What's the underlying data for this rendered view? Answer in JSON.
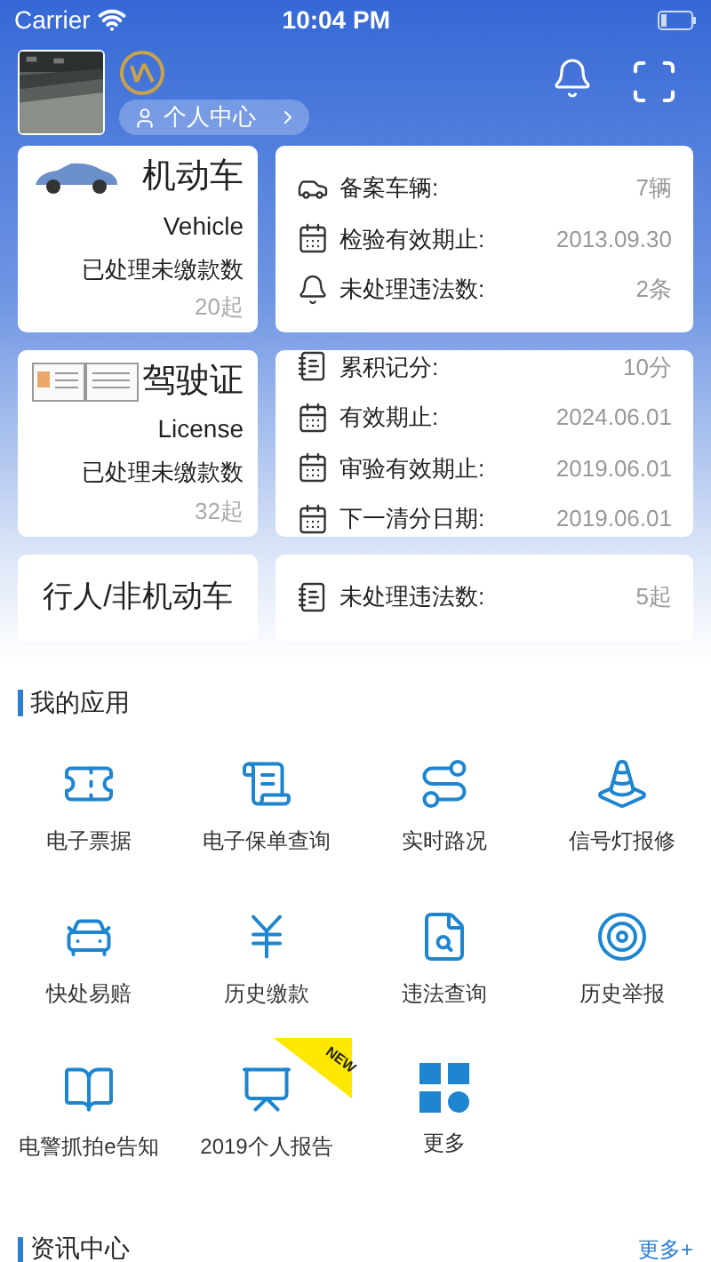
{
  "status_bar": {
    "carrier": "Carrier",
    "time": "10:04 PM"
  },
  "header": {
    "profile_link": "个人中心"
  },
  "summary_cards": [
    {
      "title": "机动车",
      "subtitle": "Vehicle",
      "caption": "已处理未缴款数",
      "count": "20起",
      "rows": [
        {
          "label": "备案车辆:",
          "value": "7辆"
        },
        {
          "label": "检验有效期止:",
          "value": "2013.09.30"
        },
        {
          "label": "未处理违法数:",
          "value": "2条"
        }
      ]
    },
    {
      "title": "驾驶证",
      "subtitle": "License",
      "caption": "已处理未缴款数",
      "count": "32起",
      "rows": [
        {
          "label": "累积记分:",
          "value": "10分"
        },
        {
          "label": "有效期止:",
          "value": "2024.06.01"
        },
        {
          "label": "审验有效期止:",
          "value": "2019.06.01"
        },
        {
          "label": "下一清分日期:",
          "value": "2019.06.01"
        }
      ]
    },
    {
      "title": "行人/非机动车",
      "rows": [
        {
          "label": "未处理违法数:",
          "value": "5起"
        }
      ]
    }
  ],
  "my_apps": {
    "title": "我的应用",
    "items": [
      {
        "label": "电子票据"
      },
      {
        "label": "电子保单查询"
      },
      {
        "label": "实时路况"
      },
      {
        "label": "信号灯报修"
      },
      {
        "label": "快处易赔"
      },
      {
        "label": "历史缴款"
      },
      {
        "label": "违法查询"
      },
      {
        "label": "历史举报"
      },
      {
        "label": "电警抓拍e告知"
      },
      {
        "label": "2019个人报告",
        "badge": "NEW"
      },
      {
        "label": "更多"
      }
    ]
  },
  "news": {
    "title": "资讯中心",
    "more": "更多+"
  }
}
